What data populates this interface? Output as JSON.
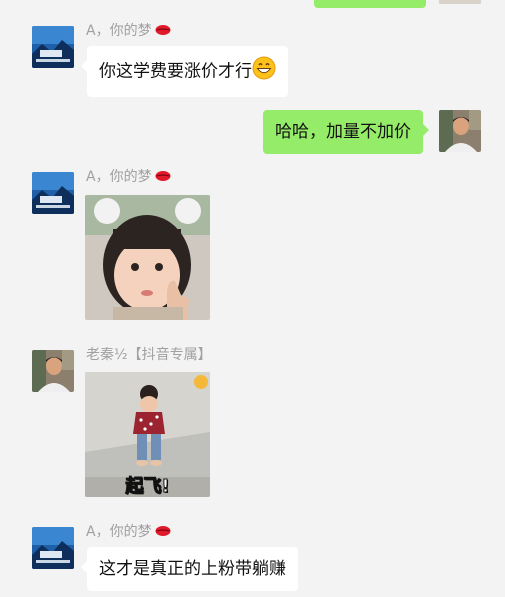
{
  "colors": {
    "background": "#f3f3f3",
    "incoming_bubble": "#ffffff",
    "outgoing_bubble": "#95ec69",
    "sender_name": "#a0a0a0"
  },
  "messages": [
    {
      "direction": "outgoing",
      "type": "partial",
      "note": "cut off at top"
    },
    {
      "direction": "incoming",
      "sender": "A，你的梦",
      "sender_icon": "lips-icon",
      "type": "text",
      "text": "你这学费要涨价才行",
      "emoji": "grinning-face-icon"
    },
    {
      "direction": "outgoing",
      "type": "text",
      "text": "哈哈，加量不加价"
    },
    {
      "direction": "incoming",
      "sender": "A，你的梦",
      "sender_icon": "lips-icon",
      "type": "image",
      "image": "child-thumbs-up-sticker"
    },
    {
      "direction": "incoming",
      "sender": "老秦½【抖音专属】",
      "type": "image",
      "image": "toddler-walking-sticker",
      "caption": "起飞!"
    },
    {
      "direction": "incoming",
      "sender": "A，你的梦",
      "sender_icon": "lips-icon",
      "type": "text",
      "text": "这才是真正的上粉带躺赚"
    }
  ]
}
